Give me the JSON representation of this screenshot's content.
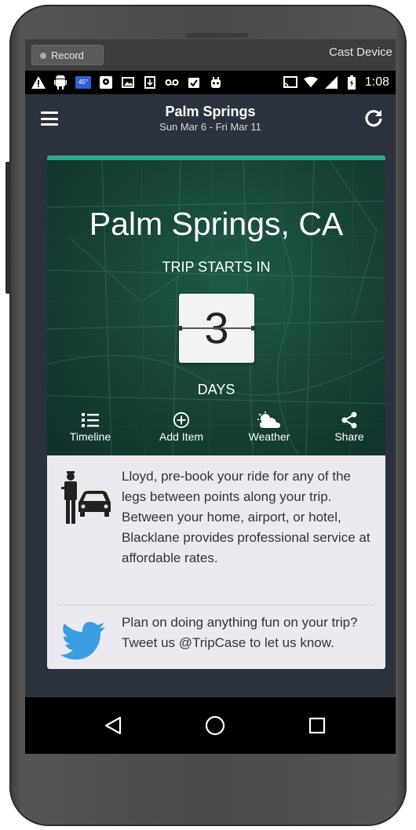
{
  "emulator": {
    "record_label": "Record",
    "cast_label": "Cast Device"
  },
  "status_bar": {
    "temperature": "45°",
    "time": "1:08",
    "icons": [
      "warning-icon",
      "android-icon",
      "weather-temp-icon",
      "maps-icon",
      "image-icon",
      "download-icon",
      "voicemail-icon",
      "clipboard-icon",
      "robot-icon",
      "cast-icon",
      "wifi-icon",
      "signal-icon",
      "battery-icon"
    ]
  },
  "header": {
    "title": "Palm Springs",
    "dates": "Sun Mar 6 - Fri Mar 11",
    "menu_icon": "hamburger-icon",
    "refresh_icon": "refresh-icon"
  },
  "trip_card": {
    "city": "Palm Springs, CA",
    "starts_label": "TRIP STARTS IN",
    "days_count": "3",
    "days_label": "DAYS",
    "accent_color": "#2fa88a",
    "actions": [
      {
        "label": "Timeline",
        "icon": "list-icon"
      },
      {
        "label": "Add Item",
        "icon": "plus-circle-icon"
      },
      {
        "label": "Weather",
        "icon": "weather-cloud-icon"
      },
      {
        "label": "Share",
        "icon": "share-icon"
      }
    ]
  },
  "promos": [
    {
      "icon": "chauffeur-car-icon",
      "text": "Lloyd, pre-book your ride for any of the legs between points along your trip. Between your home, airport, or hotel, Blacklane provides professional service at affordable rates."
    },
    {
      "icon": "twitter-bird-icon",
      "text": "Plan on doing anything fun on your trip? Tweet us @TripCase to let us know."
    }
  ],
  "nav": {
    "back_icon": "back-triangle-icon",
    "home_icon": "home-circle-icon",
    "recents_icon": "recents-square-icon"
  }
}
